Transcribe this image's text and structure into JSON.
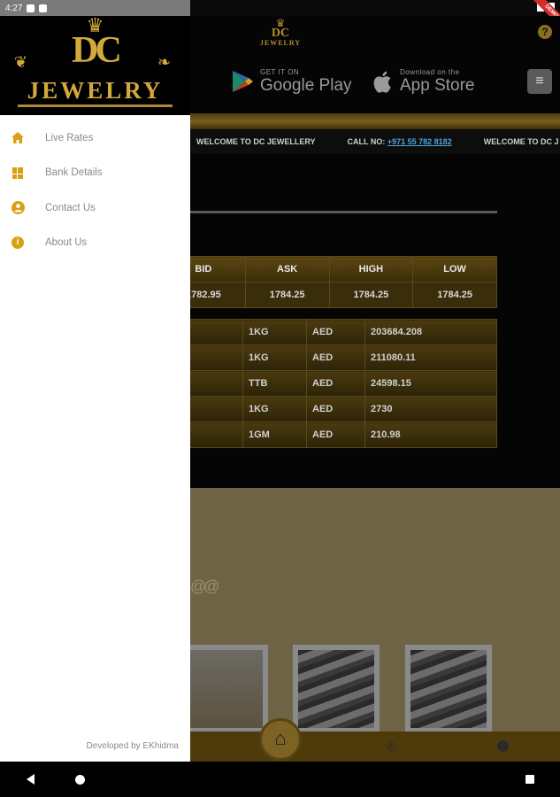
{
  "status_bar": {
    "time": "4:27",
    "ribbon_text": "DEMO"
  },
  "background_page": {
    "logo": {
      "monogram": "DC",
      "wordmark": "JEWELRY"
    },
    "stores": [
      {
        "small": "GET IT ON",
        "big": "Google Play",
        "icon": "google-play-icon"
      },
      {
        "small": "Download on the",
        "big": "App Store",
        "icon": "apple-icon"
      }
    ],
    "ticker": {
      "welcome": "WELCOME TO DC JEWELLERY",
      "call_label": "CALL NO:",
      "phone": "+971 55 782 8182",
      "welcome_repeat": "WELCOME TO DC J"
    },
    "rates_table": {
      "headers": [
        "BID",
        "ASK",
        "HIGH",
        "LOW"
      ],
      "values": [
        "1782.95",
        "1784.25",
        "1784.25",
        "1784.25"
      ]
    },
    "products": [
      {
        "unit": "1KG",
        "currency": "AED",
        "price": "203684.208"
      },
      {
        "unit": "1KG",
        "currency": "AED",
        "price": "211080.11"
      },
      {
        "unit": "TTB",
        "currency": "AED",
        "price": "24598.15"
      },
      {
        "unit": "1KG",
        "currency": "AED",
        "price": "2730"
      },
      {
        "unit": "1GM",
        "currency": "AED",
        "price": "210.98"
      }
    ]
  },
  "drawer": {
    "logo": {
      "monogram": "DC",
      "wordmark": "JEWELRY"
    },
    "items": [
      {
        "label": "Live Rates",
        "icon": "home-icon"
      },
      {
        "label": "Bank Details",
        "icon": "dashboard-icon"
      },
      {
        "label": "Contact Us",
        "icon": "account-circle-icon"
      },
      {
        "label": "About Us",
        "icon": "info-icon"
      }
    ],
    "footer": "Developed by EKhidma"
  },
  "colors": {
    "accent": "#d9a012",
    "gold_dark": "#4d3b0c",
    "drawer_bg": "#ffffff"
  }
}
